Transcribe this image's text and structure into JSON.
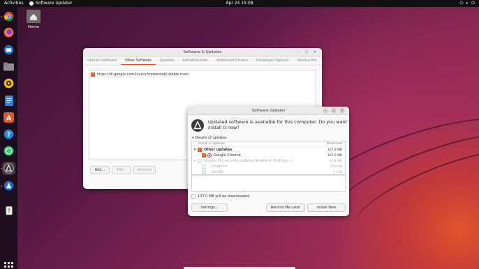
{
  "topbar": {
    "activities": "Activities",
    "app_name": "Software Updater",
    "clock": "Apr 24  15:08"
  },
  "desktop": {
    "home_label": "Home"
  },
  "dock": {
    "items": [
      {
        "name": "chrome-icon",
        "color": "#f2f2f2"
      },
      {
        "name": "firefox-icon",
        "color": "#ff7139"
      },
      {
        "name": "thunderbird-icon",
        "color": "#1f6fd1"
      },
      {
        "name": "files-icon",
        "color": "#8c8c8c"
      },
      {
        "name": "rhythmbox-icon",
        "color": "#f5c211"
      },
      {
        "name": "libreoffice-writer-icon",
        "color": "#2a7fd6"
      },
      {
        "name": "app-center-icon",
        "color": "#e95420"
      },
      {
        "name": "help-icon",
        "color": "#1f8ae0"
      },
      {
        "name": "whatsapp-icon",
        "color": "#25d366"
      },
      {
        "name": "software-updater-icon",
        "color": "#3b3b3b"
      },
      {
        "name": "software-center-icon",
        "color": "#1f6fd1"
      },
      {
        "name": "trash-icon",
        "color": "#6aa84f"
      }
    ]
  },
  "sw_updates": {
    "title": "Software & Updates",
    "tabs": [
      "Ubuntu Software",
      "Other Software",
      "Updates",
      "Authentication",
      "Additional Drivers",
      "Developer Options",
      "Ubuntu Pro"
    ],
    "source": "https://dl.google.com/linux/chrome/deb/ stable main",
    "add": "Add...",
    "edit": "Edit...",
    "remove": "Remove"
  },
  "updater": {
    "title": "Software Updater",
    "message": "Updated software is available for this computer. Do you want to install it now?",
    "details": "Details of updates",
    "col_install": "Install or remove",
    "col_download": "Download",
    "rows": [
      {
        "label": "Other updates",
        "size": "107.0 MB"
      },
      {
        "label": "Google Chrome",
        "size": "107.0 MB"
      },
      {
        "label": "Ubuntu Pro security updates (enable in Settings...)",
        "size": "67.8 MB"
      },
      {
        "label": "Graphviz",
        "size": "40.0 kB"
      },
      {
        "label": "libcdt5",
        "size": "27 kB"
      }
    ],
    "download_note": "107.0 MB will be downloaded.",
    "settings": "Settings...",
    "remind": "Remind Me Later",
    "install": "Install Now"
  }
}
